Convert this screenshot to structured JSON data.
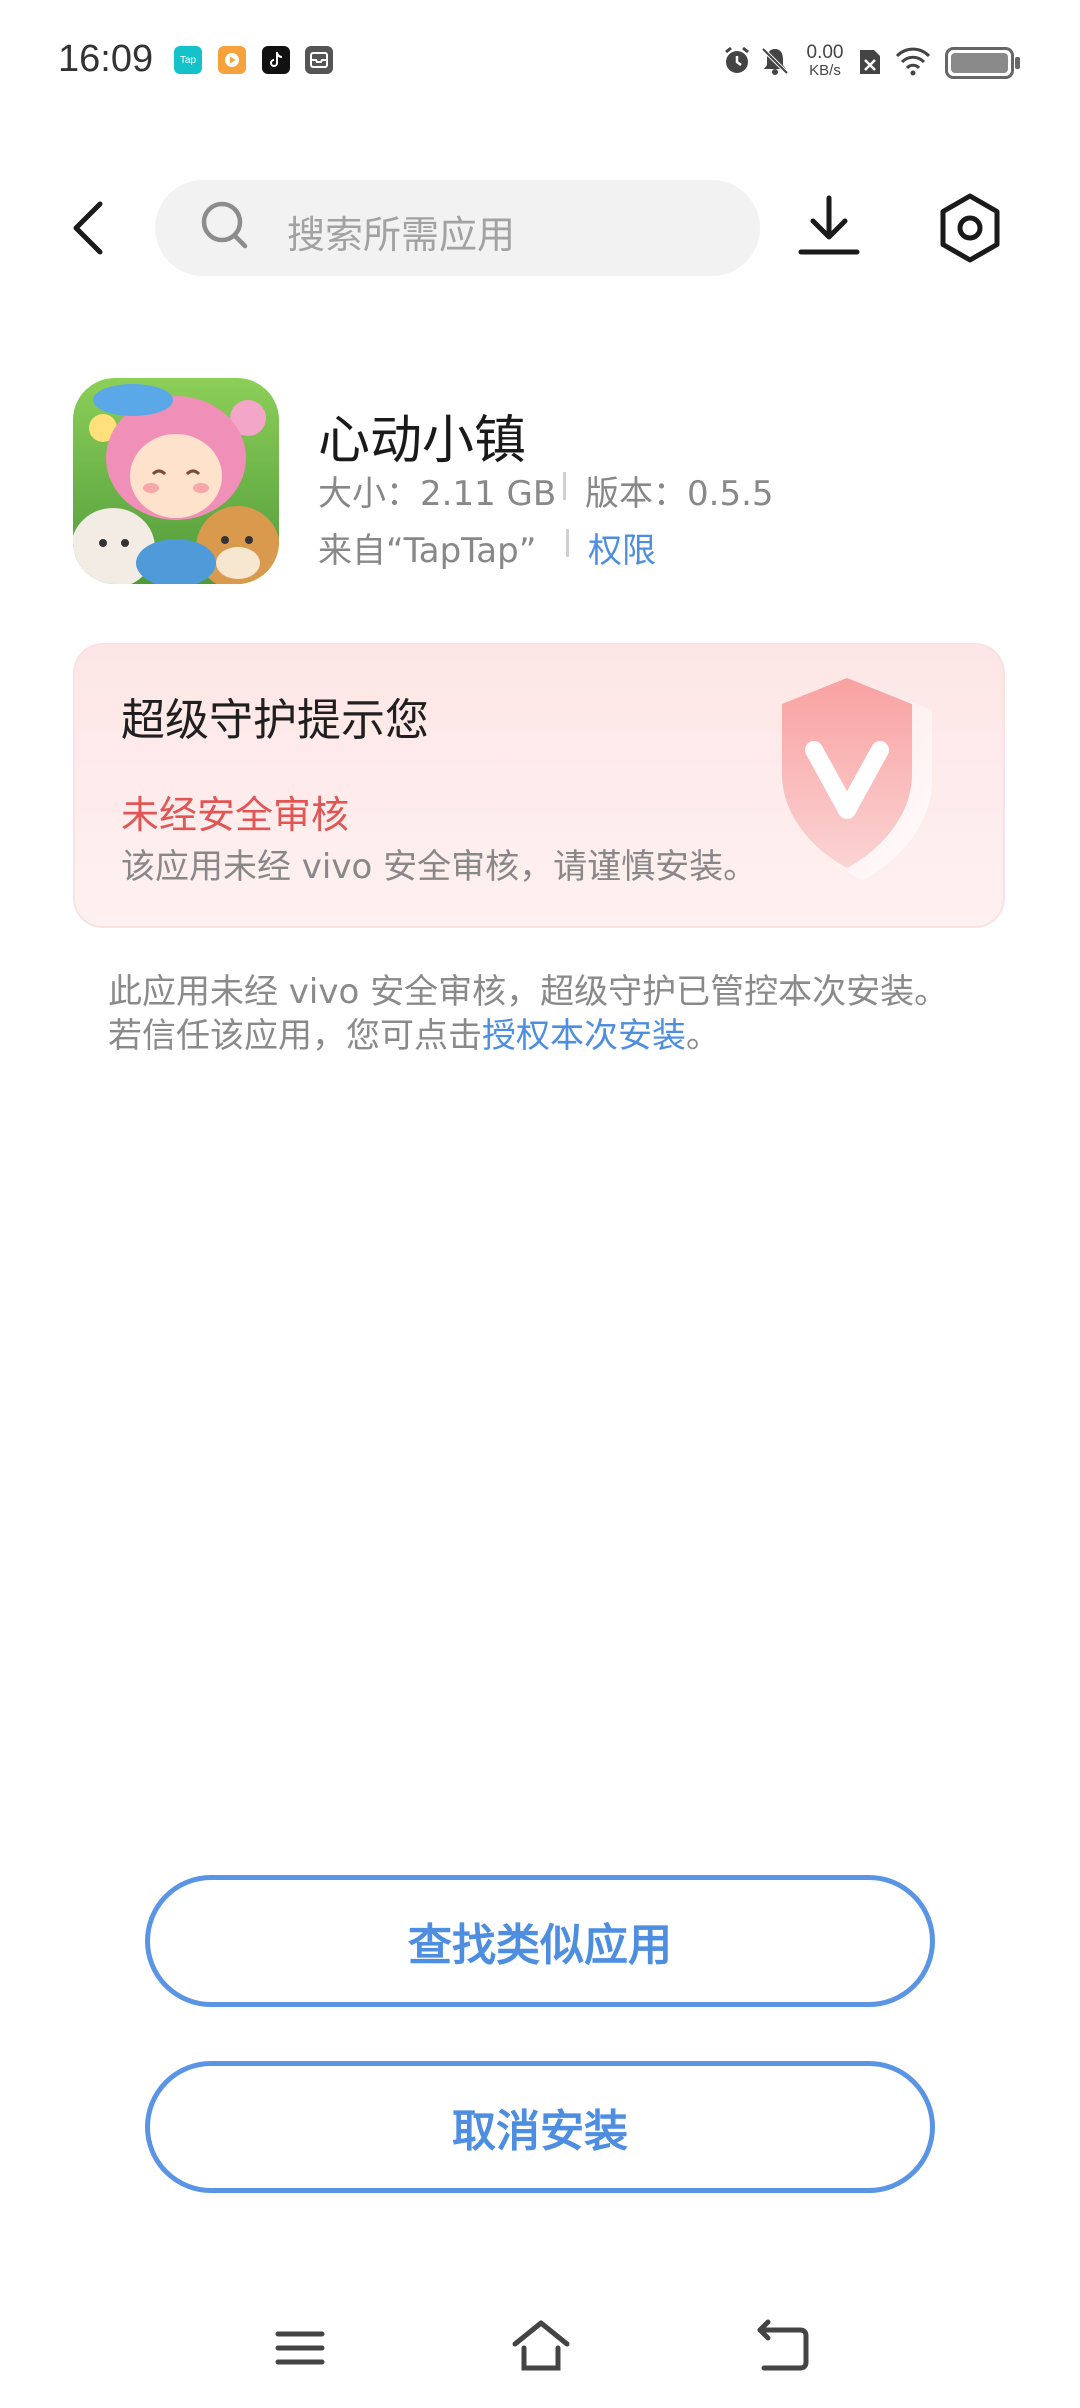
{
  "status_bar": {
    "time": "16:09",
    "notification_icons": [
      "taptap-icon",
      "video-app-icon",
      "tiktok-icon",
      "inbox-icon"
    ],
    "net_speed_value": "0.00",
    "net_speed_unit": "KB/s",
    "right_icons": [
      "alarm-icon",
      "mute-icon",
      "no-sim-icon",
      "wifi-icon",
      "battery-icon"
    ]
  },
  "header": {
    "search_placeholder": "搜索所需应用",
    "icons": [
      "back-icon",
      "search-icon",
      "download-icon",
      "settings-icon"
    ]
  },
  "app": {
    "name": "心动小镇",
    "size_label": "大小：2.11 GB",
    "version_label": "版本：0.5.5",
    "source_label": "来自“TapTap”",
    "permission_link": "权限"
  },
  "warning": {
    "title": "超级守护提示您",
    "status": "未经安全审核",
    "description": "该应用未经 vivo 安全审核，请谨慎安装。",
    "icon": "shield-v-icon",
    "accent": "#e25555"
  },
  "note": {
    "line1": "此应用未经 vivo 安全审核，超级守护已管控本次安装。",
    "line2_prefix": "若信任该应用，您可点击",
    "line2_link": "授权本次安装",
    "line2_suffix": "。"
  },
  "buttons": {
    "find_similar": "查找类似应用",
    "cancel_install": "取消安装"
  },
  "nav_bar": {
    "icons": [
      "menu-icon",
      "home-icon",
      "back-nav-icon"
    ]
  },
  "colors": {
    "accent_blue": "#4d8ee0",
    "button_border": "#5a95e5",
    "warning_red": "#e25555"
  }
}
